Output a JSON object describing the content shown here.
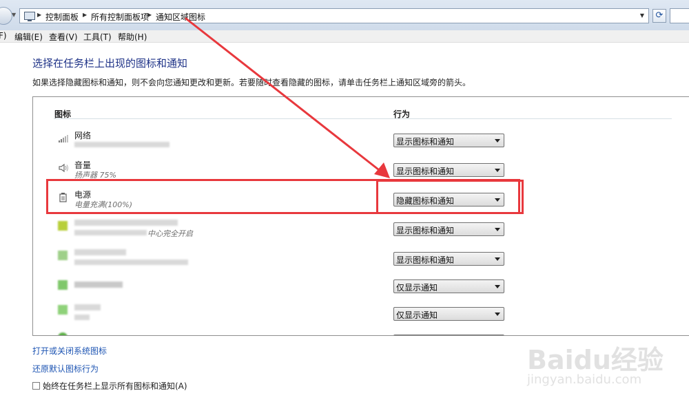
{
  "address": {
    "crumbs": [
      "控制面板",
      "所有控制面板项",
      "通知区域图标"
    ]
  },
  "menu": [
    "F)",
    "编辑(E)",
    "查看(V)",
    "工具(T)",
    "帮助(H)"
  ],
  "page": {
    "title": "选择在任务栏上出现的图标和通知",
    "description": "如果选择隐藏图标和通知，则不会向您通知更改和更新。若要随时查看隐藏的图标，请单击任务栏上通知区域旁的箭头。"
  },
  "table": {
    "col_icon": "图标",
    "col_behavior": "行为",
    "rows": [
      {
        "name": "网络",
        "sub": "",
        "behavior": "显示图标和通知",
        "icon": "network-icon"
      },
      {
        "name": "音量",
        "sub": "扬声器 75%",
        "behavior": "显示图标和通知",
        "icon": "speaker-icon"
      },
      {
        "name": "电源",
        "sub": "电量充满(100%)",
        "behavior": "隐藏图标和通知",
        "icon": "battery-icon"
      },
      {
        "name": "",
        "sub": "中心完全开启",
        "behavior": "显示图标和通知",
        "icon": "app-icon"
      },
      {
        "name": "",
        "sub": "",
        "behavior": "显示图标和通知",
        "icon": "app-icon"
      },
      {
        "name": "",
        "sub": "",
        "behavior": "仅显示通知",
        "icon": "app-icon"
      },
      {
        "name": "",
        "sub": "",
        "behavior": "仅显示通知",
        "icon": "app-icon"
      }
    ]
  },
  "links": {
    "toggle_system_icons": "打开或关闭系统图标",
    "restore_defaults": "还原默认图标行为"
  },
  "checkbox": {
    "label": "始终在任务栏上显示所有图标和通知(A)"
  },
  "watermark": {
    "text": "Baidu经验",
    "url": "jingyan.baidu.com"
  },
  "colors": {
    "annotation": "#e8383d",
    "title": "#1e3287",
    "link": "#1e55b3"
  }
}
